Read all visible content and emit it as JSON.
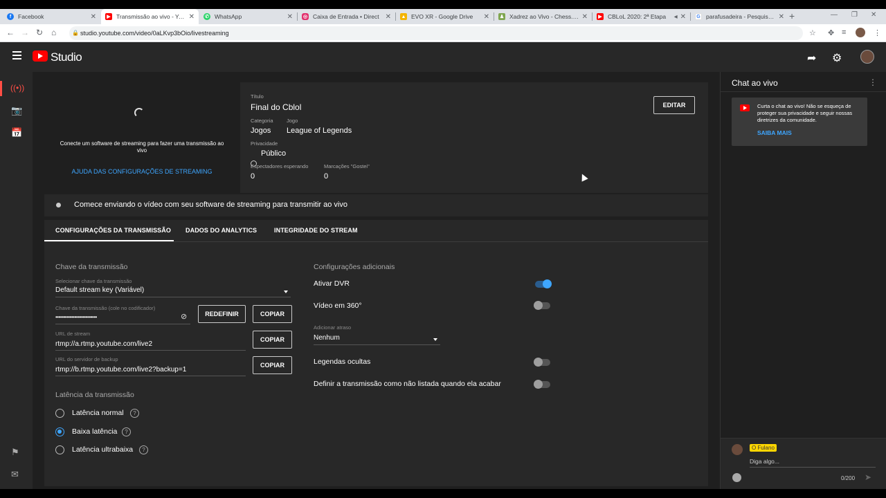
{
  "browser": {
    "tabs": [
      {
        "title": "Facebook",
        "favicon": "facebook-icon",
        "color": "#1877f2"
      },
      {
        "title": "Transmissão ao vivo - YouT",
        "favicon": "youtube-icon",
        "color": "#ff0000"
      },
      {
        "title": "WhatsApp",
        "favicon": "whatsapp-icon",
        "color": "#25d366"
      },
      {
        "title": "Caixa de Entrada • Direct",
        "favicon": "instagram-icon",
        "color": "#e1306c"
      },
      {
        "title": "EVO XR - Google Drive",
        "favicon": "google-drive-icon",
        "color": "#f4b400"
      },
      {
        "title": "Xadrez ao Vivo - Chess.com",
        "favicon": "chess-icon",
        "color": "#7fa650"
      },
      {
        "title": "CBLoL 2020: 2ª Etapa",
        "favicon": "youtube-icon",
        "color": "#ff0000"
      },
      {
        "title": "parafusadeira - Pesquisa Go",
        "favicon": "google-icon",
        "color": "#4285f4"
      }
    ],
    "url": "studio.youtube.com/video/0aLKvp3bOio/livestreaming"
  },
  "header": {
    "logo_text": "Studio"
  },
  "preview": {
    "message": "Conecte um software de streaming para fazer uma transmissão ao vivo",
    "help_link": "AJUDA DAS CONFIGURAÇÕES DE STREAMING"
  },
  "info": {
    "title_label": "Título",
    "title_value": "Final do Cblol",
    "category_label": "Categoria",
    "category_value": "Jogos",
    "game_label": "Jogo",
    "game_value": "League of Legends",
    "privacy_label": "Privacidade",
    "privacy_value": "Público",
    "waiting_label": "Espectadores esperando",
    "waiting_value": "0",
    "likes_label": "Marcações \"Gostei\"",
    "likes_value": "0",
    "edit_button": "EDITAR"
  },
  "status": {
    "text": "Comece enviando o vídeo com seu software de streaming para transmitir ao vivo"
  },
  "tabs": [
    {
      "label": "CONFIGURAÇÕES DA TRANSMISSÃO"
    },
    {
      "label": "DADOS DO ANALYTICS"
    },
    {
      "label": "INTEGRIDADE DO STREAM"
    }
  ],
  "stream_key": {
    "section_title": "Chave da transmissão",
    "select_label": "Selecionar chave da transmissão",
    "select_value": "Default stream key (Variável)",
    "key_label": "Chave da transmissão (cole no codificador)",
    "key_value": "••••••••••••••••••••••••••",
    "reset_button": "REDEFINIR",
    "copy_button": "COPIAR",
    "url_label": "URL de stream",
    "url_value": "rtmp://a.rtmp.youtube.com/live2",
    "backup_label": "URL do servidor de backup",
    "backup_value": "rtmp://b.rtmp.youtube.com/live2?backup=1"
  },
  "latency": {
    "section_title": "Latência da transmissão",
    "options": [
      {
        "label": "Latência normal",
        "selected": false
      },
      {
        "label": "Baixa latência",
        "selected": true
      },
      {
        "label": "Latência ultrabaixa",
        "selected": false
      }
    ]
  },
  "additional": {
    "section_title": "Configurações adicionais",
    "dvr_label": "Ativar DVR",
    "dvr_on": true,
    "video360_label": "Vídeo em 360°",
    "video360_on": false,
    "delay_label": "Adicionar atraso",
    "delay_value": "Nenhum",
    "captions_label": "Legendas ocultas",
    "captions_on": false,
    "unlisted_label": "Definir a transmissão como não listada quando ela acabar",
    "unlisted_on": false
  },
  "chat": {
    "title": "Chat ao vivo",
    "card_message": "Curta o chat ao vivo! Não se esqueça de proteger sua privacidade e seguir nossas diretrizes da comunidade.",
    "card_link": "SAIBA MAIS",
    "user_name": "O Fulano",
    "placeholder": "Diga algo...",
    "char_count": "0/200"
  },
  "colors": {
    "accent": "#3ea6ff",
    "live_red": "#ff4e45",
    "username_badge": "#ffd600"
  }
}
